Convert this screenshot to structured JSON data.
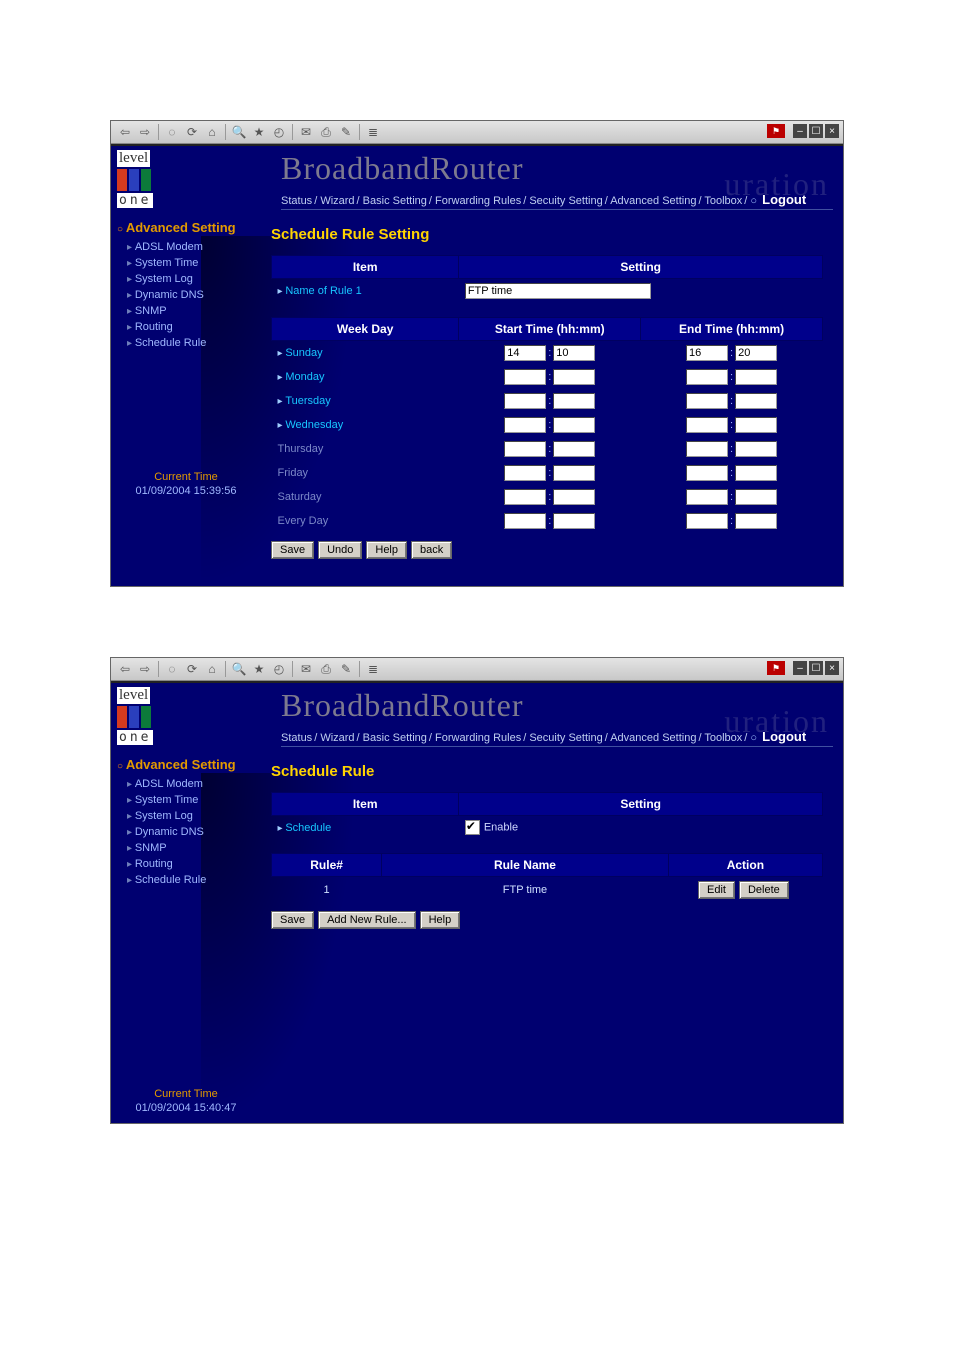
{
  "header": {
    "brand_title": "BroadbandRouter",
    "ghost_text": "uration",
    "logo_line1": "level",
    "logo_line2": "one",
    "tabs": [
      "Status",
      "Wizard",
      "Basic Setting",
      "Forwarding Rules",
      "Secuity Setting",
      "Advanced Setting",
      "Toolbox"
    ],
    "logout": "Logout"
  },
  "sidebar": {
    "category": "Advanced Setting",
    "items": [
      "ADSL Modem",
      "System Time",
      "System Log",
      "Dynamic DNS",
      "SNMP",
      "Routing",
      "Schedule Rule"
    ],
    "current_time_label": "Current Time"
  },
  "toolbar_icons": [
    "back",
    "forward",
    "stop",
    "refresh",
    "home",
    "search",
    "favorites",
    "history",
    "mail",
    "print",
    "edit",
    "discuss"
  ],
  "window_controls": {
    "min": "–",
    "max": "☐",
    "close": "×"
  },
  "screens": [
    {
      "current_time": "01/09/2004 15:39:56",
      "page_title": "Schedule Rule Setting",
      "item_header": "Item",
      "setting_header": "Setting",
      "rule_name_label": "Name of Rule 1",
      "rule_name_value": "FTP time",
      "col_weekday": "Week Day",
      "col_start": "Start Time (hh:mm)",
      "col_end": "End Time (hh:mm)",
      "rows": [
        {
          "day": "Sunday",
          "sh": "14",
          "sm": "10",
          "eh": "16",
          "em": "20",
          "dim": false
        },
        {
          "day": "Monday",
          "sh": "",
          "sm": "",
          "eh": "",
          "em": "",
          "dim": false
        },
        {
          "day": "Tuersday",
          "sh": "",
          "sm": "",
          "eh": "",
          "em": "",
          "dim": false
        },
        {
          "day": "Wednesday",
          "sh": "",
          "sm": "",
          "eh": "",
          "em": "",
          "dim": false
        },
        {
          "day": "Thursday",
          "sh": "",
          "sm": "",
          "eh": "",
          "em": "",
          "dim": true
        },
        {
          "day": "Friday",
          "sh": "",
          "sm": "",
          "eh": "",
          "em": "",
          "dim": true
        },
        {
          "day": "Saturday",
          "sh": "",
          "sm": "",
          "eh": "",
          "em": "",
          "dim": true
        },
        {
          "day": "Every Day",
          "sh": "",
          "sm": "",
          "eh": "",
          "em": "",
          "dim": true
        }
      ],
      "buttons": [
        "Save",
        "Undo",
        "Help",
        "back"
      ]
    },
    {
      "current_time": "01/09/2004 15:40:47",
      "page_title": "Schedule Rule",
      "item_header": "Item",
      "setting_header": "Setting",
      "schedule_label": "Schedule",
      "enable_label": "Enable",
      "enable_checked": true,
      "col_rule_no": "Rule#",
      "col_rule_name": "Rule Name",
      "col_action": "Action",
      "rules": [
        {
          "no": "1",
          "name": "FTP time"
        }
      ],
      "row_buttons": [
        "Edit",
        "Delete"
      ],
      "buttons": [
        "Save",
        "Add New Rule...",
        "Help"
      ]
    }
  ]
}
